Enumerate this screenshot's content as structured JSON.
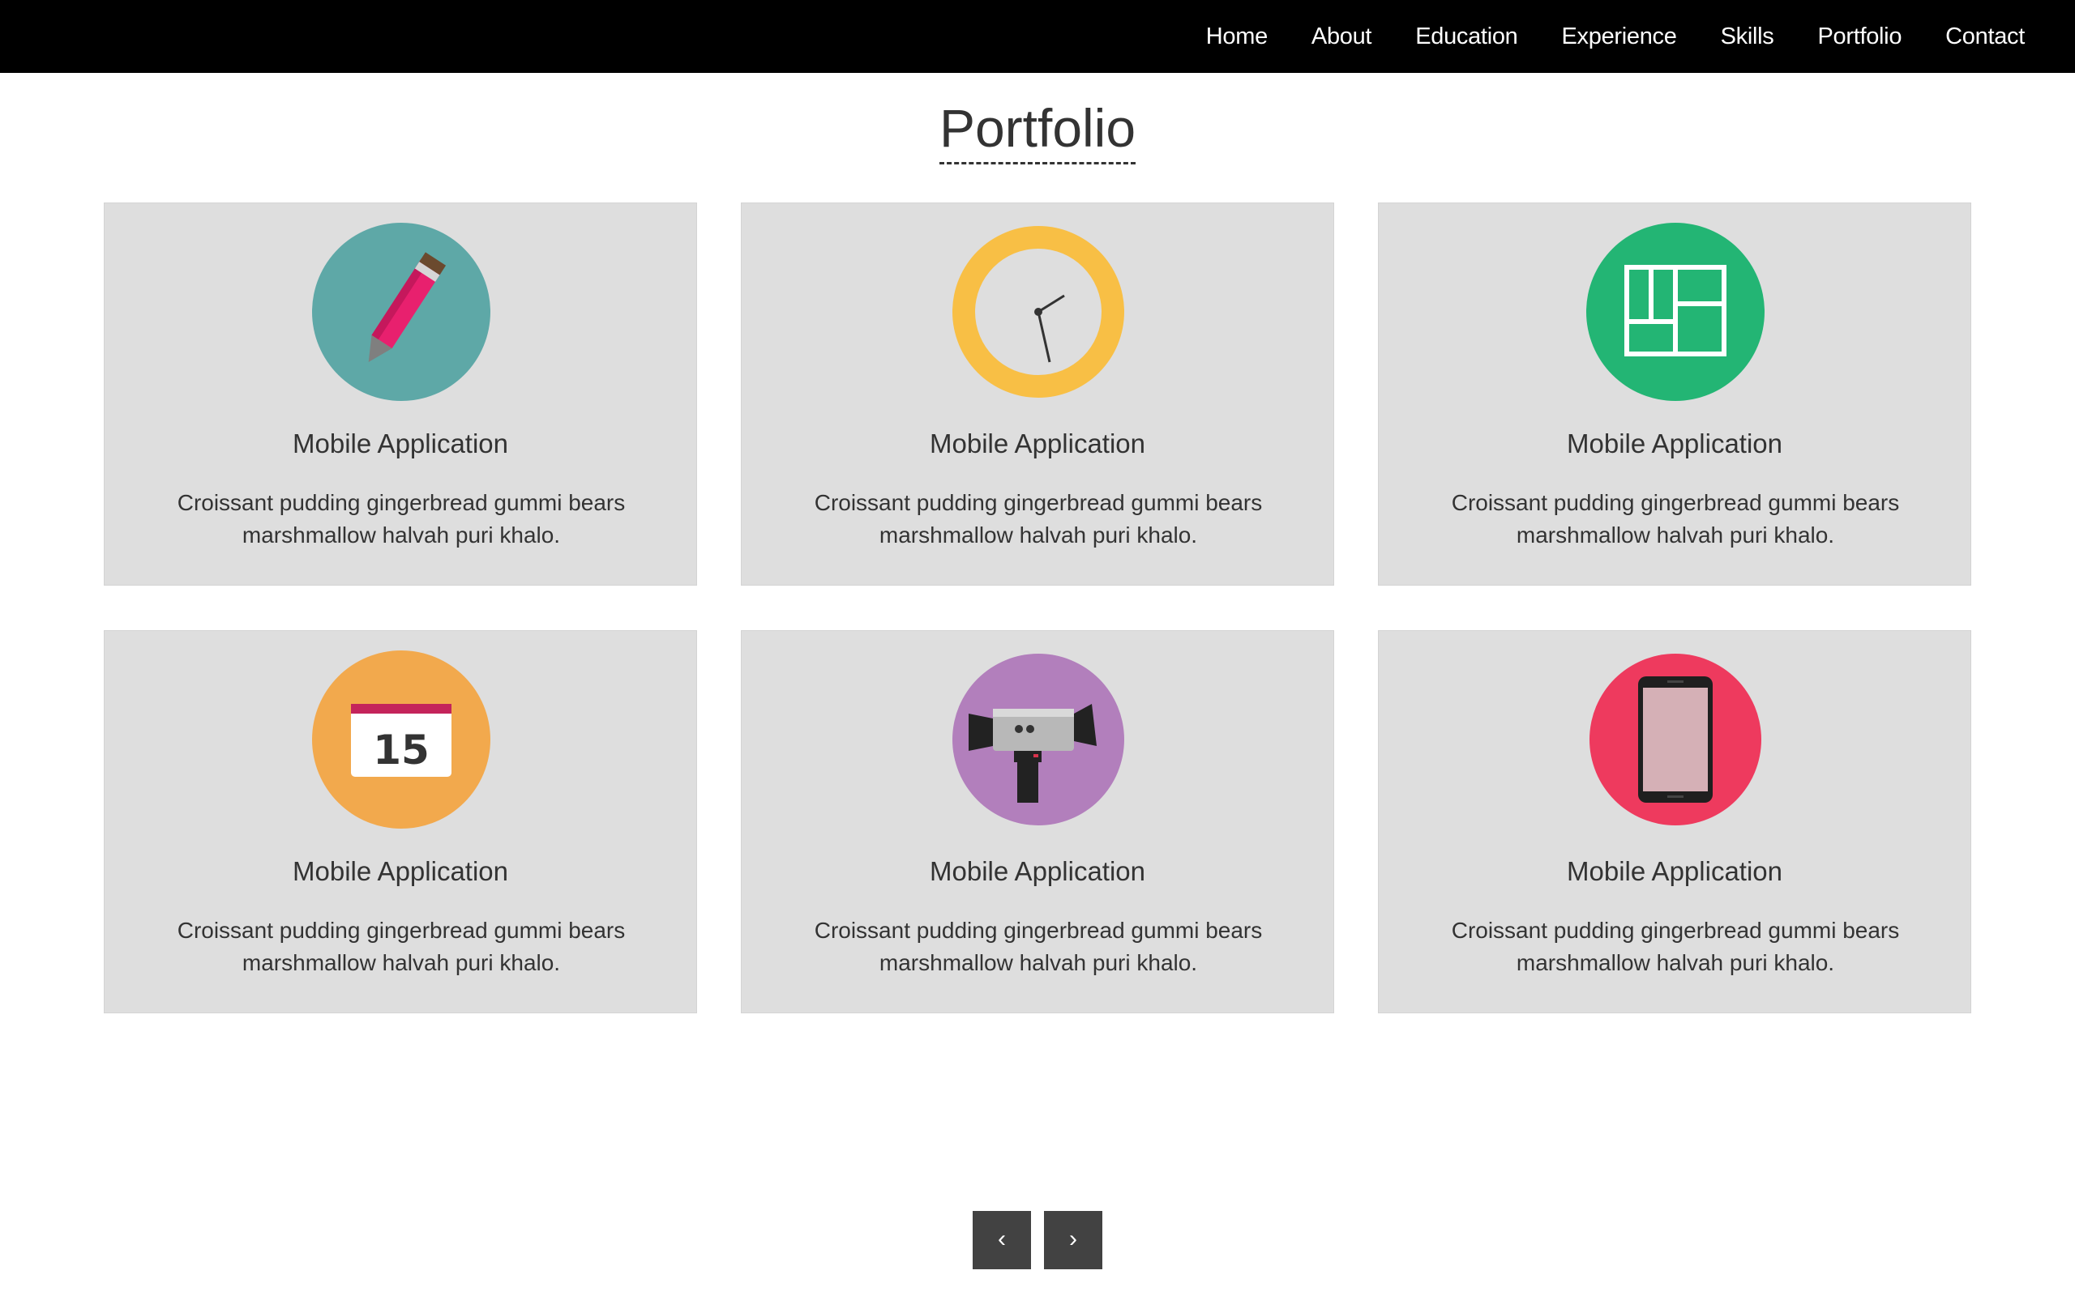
{
  "nav": {
    "items": [
      {
        "label": "Home"
      },
      {
        "label": "About"
      },
      {
        "label": "Education"
      },
      {
        "label": "Experience"
      },
      {
        "label": "Skills"
      },
      {
        "label": "Portfolio"
      },
      {
        "label": "Contact"
      }
    ]
  },
  "page": {
    "title": "Portfolio"
  },
  "portfolio": {
    "cards": [
      {
        "icon": "pencil-icon",
        "title": "Mobile Application",
        "description": "Croissant pudding gingerbread gummi bears marshmallow halvah puri khalo.",
        "color": "#5ea8a7"
      },
      {
        "icon": "clock-icon",
        "title": "Mobile Application",
        "description": "Croissant pudding gingerbread gummi bears marshmallow halvah puri khalo.",
        "color": "#f8bf45"
      },
      {
        "icon": "layout-grid-icon",
        "title": "Mobile Application",
        "description": "Croissant pudding gingerbread gummi bears marshmallow halvah puri khalo.",
        "color": "#23b574"
      },
      {
        "icon": "calendar-icon",
        "title": "Mobile Application",
        "description": "Croissant pudding gingerbread gummi bears marshmallow halvah puri khalo.",
        "color": "#f2a94d",
        "calendar_day": "15"
      },
      {
        "icon": "video-camera-icon",
        "title": "Mobile Application",
        "description": "Croissant pudding gingerbread gummi bears marshmallow halvah puri khalo.",
        "color": "#b27fbc"
      },
      {
        "icon": "smartphone-icon",
        "title": "Mobile Application",
        "description": "Croissant pudding gingerbread gummi bears marshmallow halvah puri khalo.",
        "color": "#ee3a5e"
      }
    ]
  },
  "pagination": {
    "prev_label": "‹",
    "next_label": "›"
  }
}
